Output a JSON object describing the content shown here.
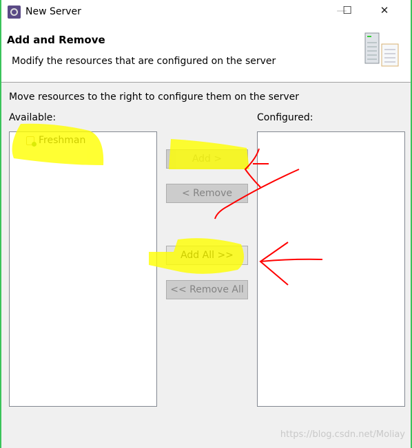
{
  "window": {
    "title": "New Server",
    "minimize": "—",
    "maximize": "☐",
    "close": "✕"
  },
  "header": {
    "title": "Add and Remove",
    "subtitle": "Modify the resources that are configured on the server",
    "icon": "server-icon"
  },
  "instructions": "Move resources to the right to configure them on the server",
  "available": {
    "label": "Available:",
    "items": [
      {
        "label": "Freshman",
        "icon": "project-icon"
      }
    ]
  },
  "configured": {
    "label": "Configured:",
    "items": []
  },
  "buttons": {
    "add": "Add >",
    "remove": "< Remove",
    "add_all": "Add All >>",
    "remove_all": "<< Remove All"
  },
  "watermark": "https://blog.csdn.net/Moliay",
  "colors": {
    "highlight": "#ffff00",
    "annotation": "#ff0000"
  }
}
